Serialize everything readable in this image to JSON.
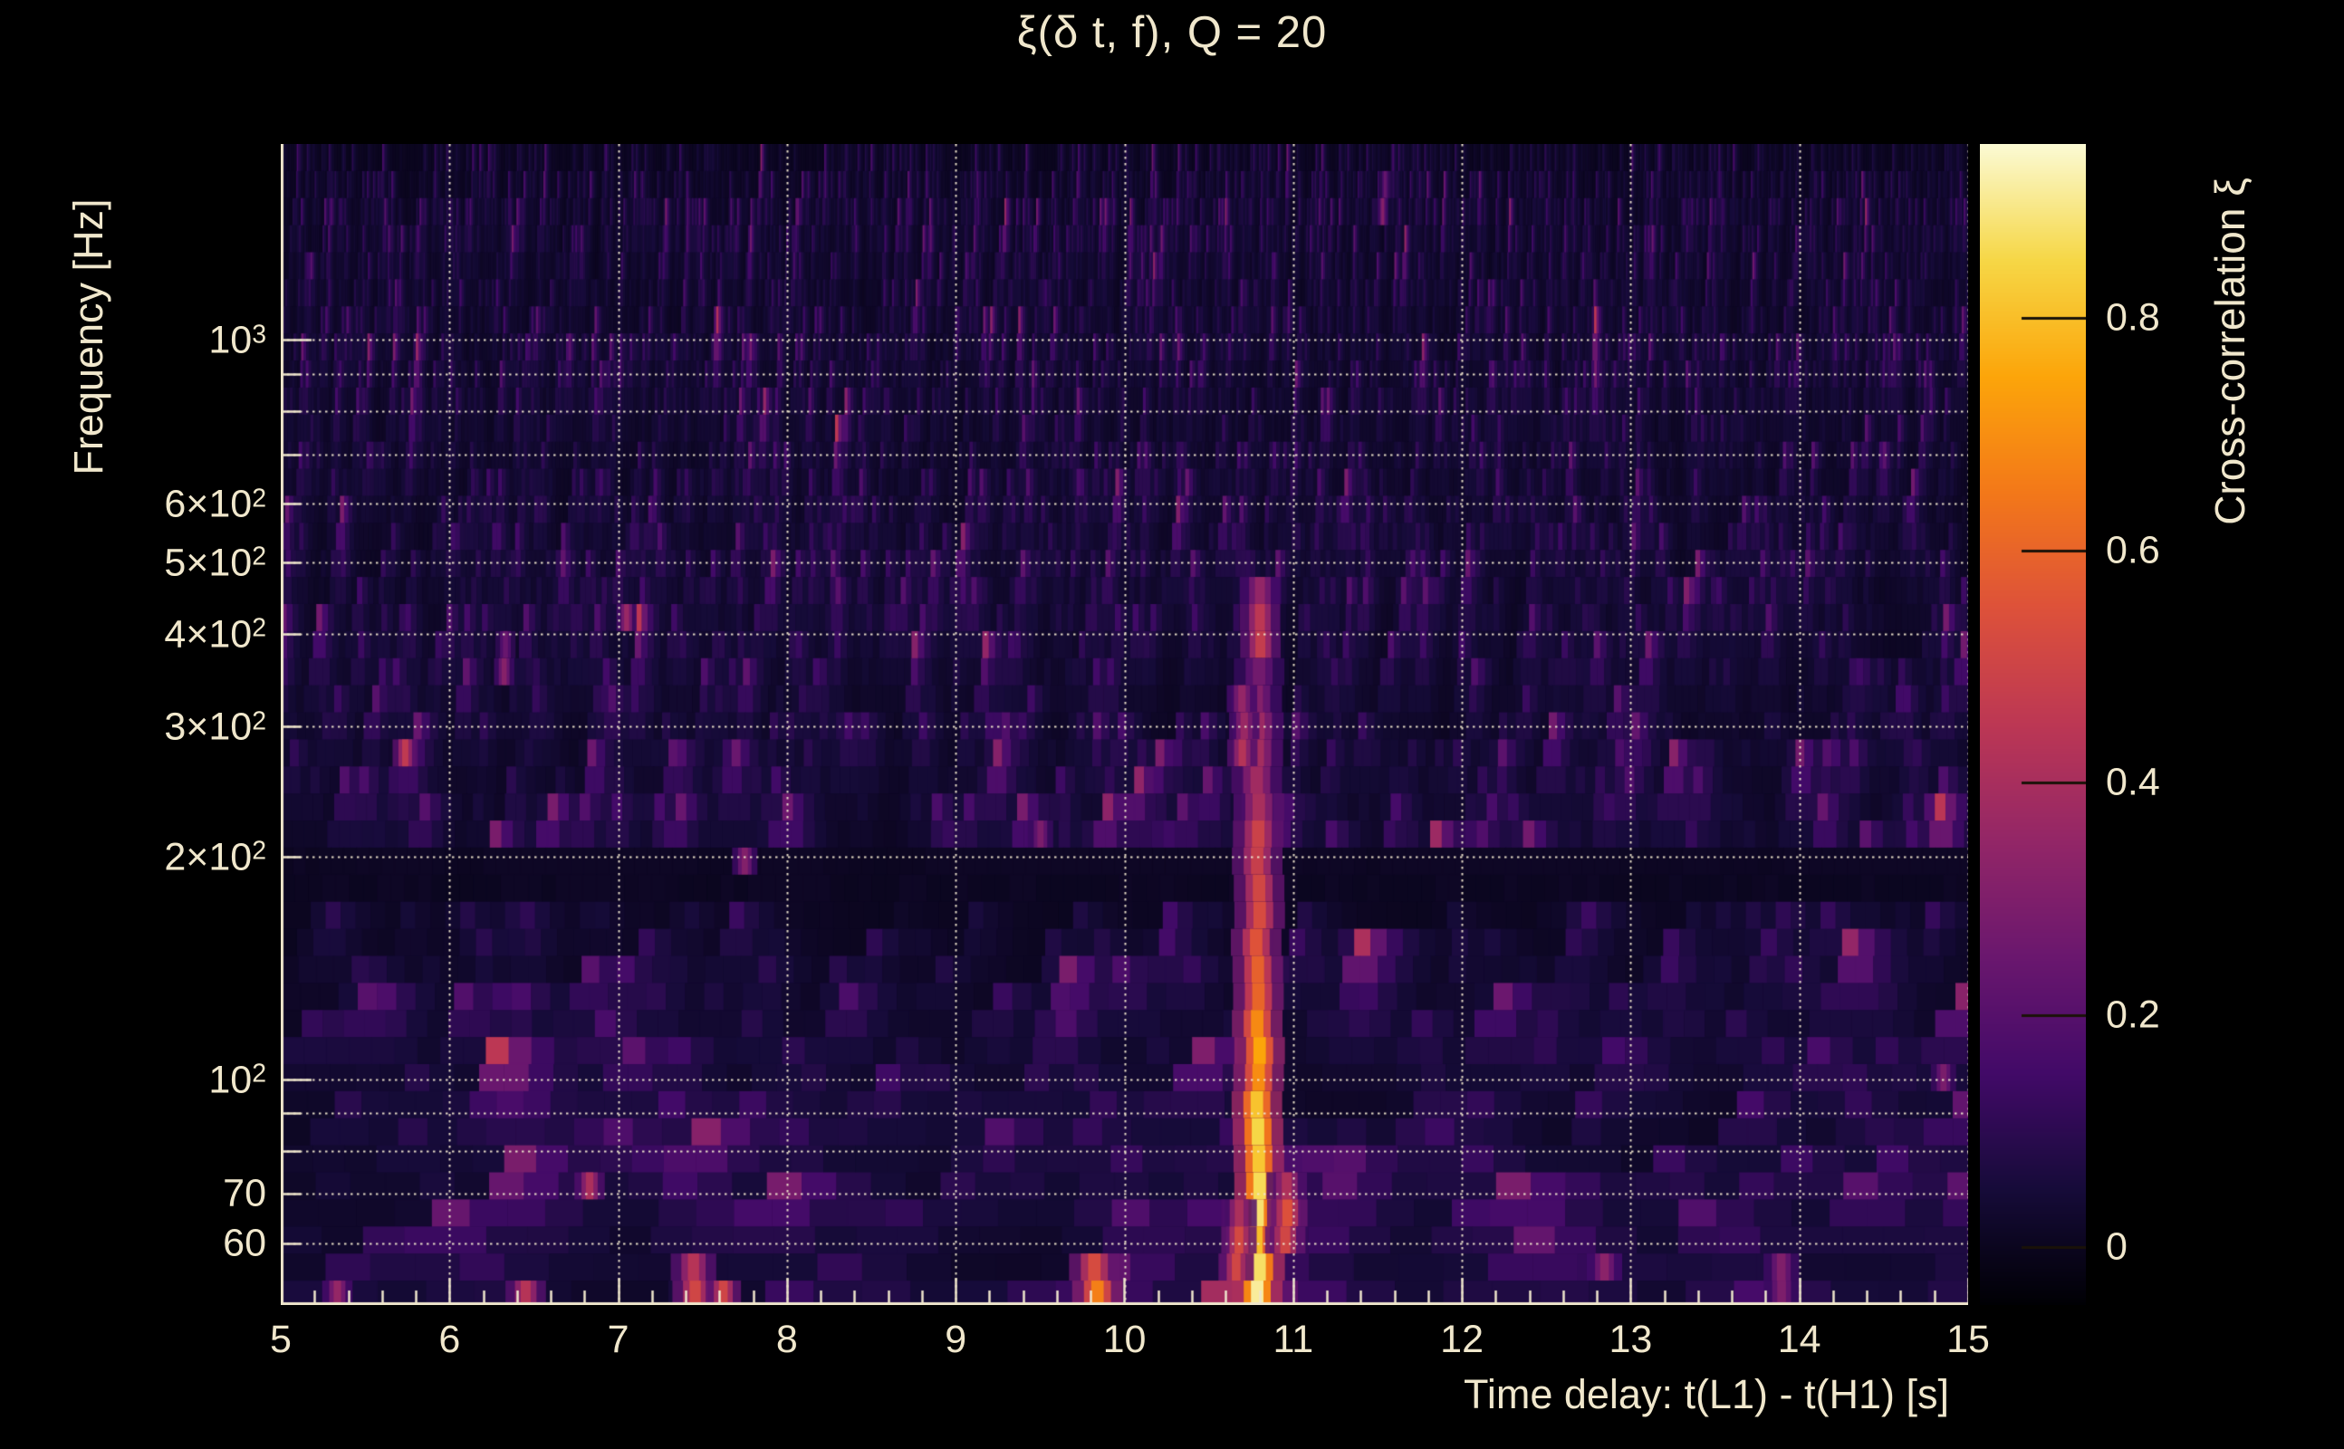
{
  "figure": {
    "background_color": "#000000",
    "text_color": "#f0e7cc",
    "gridline_color": "#efe6cc"
  },
  "chart_data": {
    "type": "heatmap",
    "title": "ξ(δ t, f), Q = 20",
    "xlabel": "Time delay: t(L1) - t(H1) [s]",
    "ylabel": "Frequency [Hz]",
    "colorbar_label": "Cross-correlation ξ",
    "colormap": "inferno",
    "x_range": [
      5,
      15
    ],
    "x_ticks": [
      "5",
      "6",
      "7",
      "8",
      "9",
      "10",
      "11",
      "12",
      "13",
      "14",
      "15"
    ],
    "x_tick_values": [
      5,
      6,
      7,
      8,
      9,
      10,
      11,
      12,
      13,
      14,
      15
    ],
    "x_minor_tick_step": 0.2,
    "y_scale": "log",
    "y_range_hz": [
      49.5,
      1840
    ],
    "y_tick_labels": [
      {
        "value": 1000,
        "label": "10^3"
      },
      {
        "value": 600,
        "label": "6×10^2"
      },
      {
        "value": 500,
        "label": "5×10^2"
      },
      {
        "value": 400,
        "label": "4×10^2"
      },
      {
        "value": 300,
        "label": "3×10^2"
      },
      {
        "value": 200,
        "label": "2×10^2"
      },
      {
        "value": 100,
        "label": "10^2"
      },
      {
        "value": 70,
        "label": "70"
      },
      {
        "value": 60,
        "label": "60"
      }
    ],
    "y_gridlines_hz": [
      60,
      70,
      80,
      90,
      100,
      200,
      300,
      400,
      500,
      600,
      700,
      800,
      900,
      1000
    ],
    "grid": "dotted",
    "colorbar_range": [
      -0.05,
      0.95
    ],
    "colorbar_ticks": [
      {
        "value": 0.8,
        "label": "0.8"
      },
      {
        "value": 0.6,
        "label": "0.6"
      },
      {
        "value": 0.4,
        "label": "0.4"
      },
      {
        "value": 0.2,
        "label": "0.2"
      },
      {
        "value": 0.0,
        "label": "0"
      }
    ],
    "peak": {
      "time_delay_s": 10.79,
      "xi": 0.95,
      "freq_extent_hz": [
        50,
        370
      ]
    },
    "notch_band_hz": [
      176,
      200
    ],
    "background_noise": {
      "description": "mottled dark-purple Q-transform noise floor, vertical striations narrower at high frequency",
      "xi_floor_range": [
        -0.05,
        0.2
      ],
      "seed": 911
    },
    "features": [
      {
        "name": "primary-correlation-streak",
        "t": 10.79,
        "f_lo": 50,
        "f_hi": 370,
        "xi": 0.95,
        "xi_top": 0.28,
        "width_s": 0.1
      },
      {
        "name": "streak-upper-blob",
        "t": 10.81,
        "f_lo": 380,
        "f_hi": 475,
        "xi": 0.5,
        "xi_top": 0.35,
        "width_s": 0.08
      },
      {
        "name": "streak-left-patch",
        "t": 10.7,
        "f_lo": 255,
        "f_hi": 330,
        "xi": 0.45,
        "xi_top": 0.35,
        "width_s": 0.06
      },
      {
        "name": "streak-left-base",
        "t": 10.67,
        "f_lo": 54,
        "f_hi": 66,
        "xi": 0.55,
        "xi_top": 0.45,
        "width_s": 0.07
      },
      {
        "name": "streak-right-base",
        "t": 10.96,
        "f_lo": 57,
        "f_hi": 76,
        "xi": 0.6,
        "xi_top": 0.4,
        "width_s": 0.08
      },
      {
        "name": "hotspot",
        "t": 9.83,
        "f_lo": 51,
        "f_hi": 58,
        "xi": 0.62,
        "xi_top": 0.5,
        "width_s": 0.1
      },
      {
        "name": "hotspot",
        "t": 7.45,
        "f_lo": 51,
        "f_hi": 58,
        "xi": 0.55,
        "xi_top": 0.42,
        "width_s": 0.09
      },
      {
        "name": "hotspot",
        "t": 7.63,
        "f_lo": 50,
        "f_hi": 55,
        "xi": 0.5,
        "xi_top": 0.4,
        "width_s": 0.07
      },
      {
        "name": "hotspot",
        "t": 6.45,
        "f_lo": 49.5,
        "f_hi": 53,
        "xi": 0.55,
        "xi_top": 0.4,
        "width_s": 0.08
      },
      {
        "name": "hotspot",
        "t": 5.33,
        "f_lo": 49.5,
        "f_hi": 53,
        "xi": 0.42,
        "xi_top": 0.3,
        "width_s": 0.06
      },
      {
        "name": "hotspot",
        "t": 6.83,
        "f_lo": 66,
        "f_hi": 77,
        "xi": 0.45,
        "xi_top": 0.32,
        "width_s": 0.06
      },
      {
        "name": "hotspot",
        "t": 5.74,
        "f_lo": 262,
        "f_hi": 300,
        "xi": 0.5,
        "xi_top": 0.35,
        "width_s": 0.05
      },
      {
        "name": "hotspot",
        "t": 7.06,
        "f_lo": 400,
        "f_hi": 445,
        "xi": 0.38,
        "xi_top": 0.3,
        "width_s": 0.04
      },
      {
        "name": "hotspot",
        "t": 6.33,
        "f_lo": 350,
        "f_hi": 395,
        "xi": 0.3,
        "xi_top": 0.25,
        "width_s": 0.04
      },
      {
        "name": "hotspot",
        "t": 11.54,
        "f_lo": 1480,
        "f_hi": 1700,
        "xi": 0.3,
        "xi_top": 0.25,
        "width_s": 0.02
      },
      {
        "name": "hotspot",
        "t": 7.74,
        "f_lo": 188,
        "f_hi": 205,
        "xi": 0.36,
        "xi_top": 0.3,
        "width_s": 0.05
      },
      {
        "name": "hotspot",
        "t": 9.5,
        "f_lo": 200,
        "f_hi": 216,
        "xi": 0.32,
        "xi_top": 0.28,
        "width_s": 0.05
      },
      {
        "name": "hotspot",
        "t": 14.85,
        "f_lo": 93,
        "f_hi": 106,
        "xi": 0.34,
        "xi_top": 0.28,
        "width_s": 0.05
      },
      {
        "name": "hotspot",
        "t": 12.85,
        "f_lo": 52,
        "f_hi": 58,
        "xi": 0.35,
        "xi_top": 0.3,
        "width_s": 0.07
      },
      {
        "name": "hotspot",
        "t": 13.9,
        "f_lo": 50,
        "f_hi": 56,
        "xi": 0.32,
        "xi_top": 0.28,
        "width_s": 0.07
      }
    ]
  }
}
